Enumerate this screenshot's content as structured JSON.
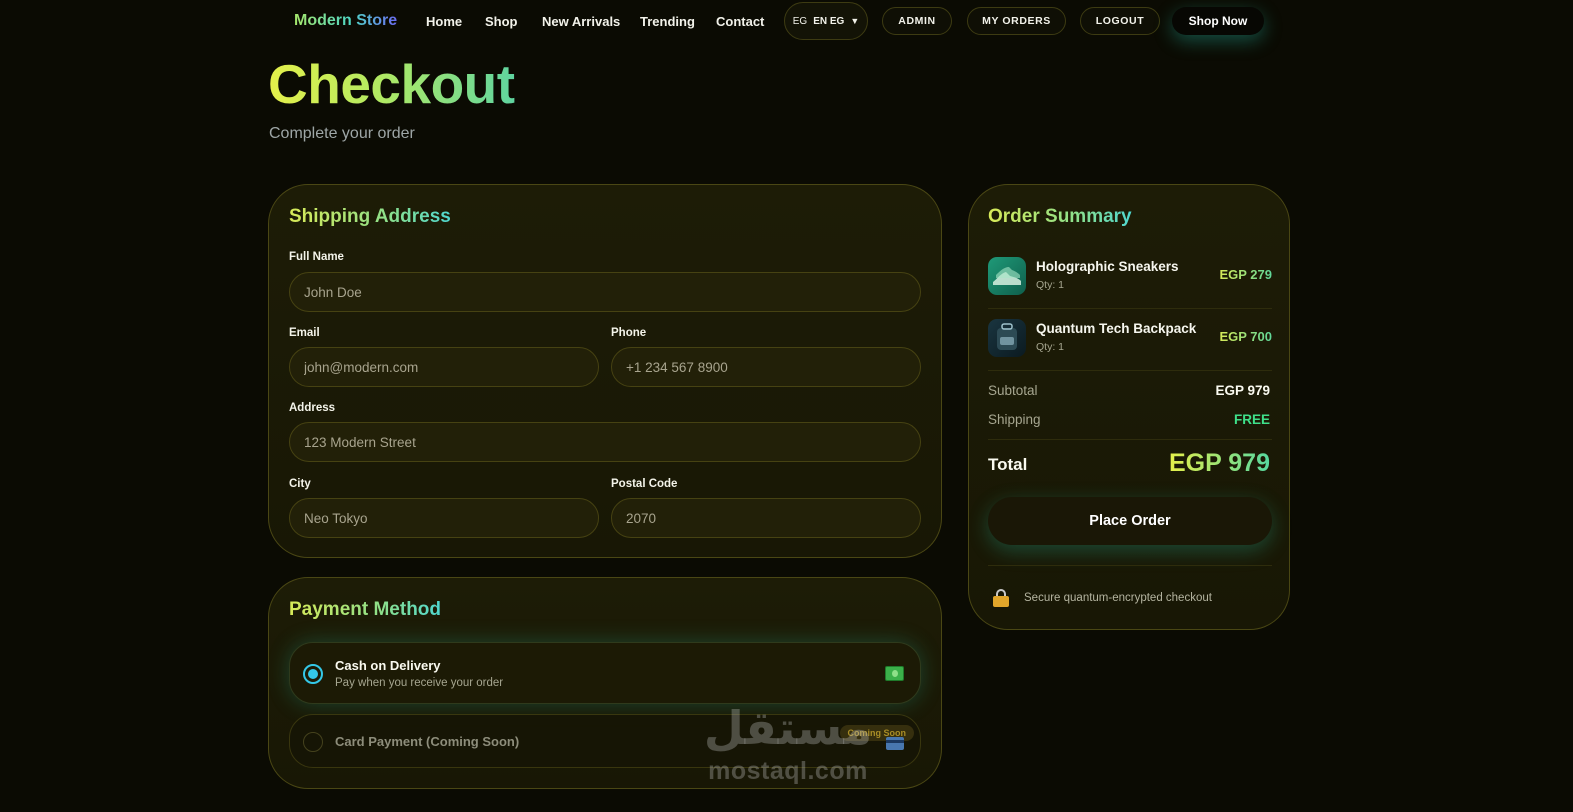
{
  "nav": {
    "brand": "Modern Store",
    "links": [
      "Home",
      "Shop",
      "New Arrivals",
      "Trending",
      "Contact"
    ],
    "language": {
      "flag": "EG",
      "label": "EN EG",
      "caret": "▼"
    },
    "admin_label": "ADMIN",
    "orders_label": "MY ORDERS",
    "logout_label": "LOGOUT",
    "shop_now_label": "Shop Now"
  },
  "header": {
    "title": "Checkout",
    "subtitle": "Complete your order"
  },
  "shipping": {
    "title": "Shipping Address",
    "full_name": {
      "label": "Full Name",
      "placeholder": "John Doe"
    },
    "email": {
      "label": "Email",
      "placeholder": "john@modern.com"
    },
    "phone": {
      "label": "Phone",
      "placeholder": "+1 234 567 8900"
    },
    "address": {
      "label": "Address",
      "placeholder": "123 Modern Street"
    },
    "city": {
      "label": "City",
      "placeholder": "Neo Tokyo"
    },
    "postal": {
      "label": "Postal Code",
      "placeholder": "2070"
    }
  },
  "payment": {
    "title": "Payment Method",
    "options": [
      {
        "title": "Cash on Delivery",
        "description": "Pay when you receive your order",
        "icon": "money-icon",
        "selected": true
      },
      {
        "title": "Card Payment (Coming Soon)",
        "badge": "Coming Soon",
        "icon": "credit-card-icon",
        "selected": false
      }
    ]
  },
  "summary": {
    "title": "Order Summary",
    "items": [
      {
        "name": "Holographic Sneakers",
        "qty": "Qty: 1",
        "price": "EGP 279"
      },
      {
        "name": "Quantum Tech Backpack",
        "qty": "Qty: 1",
        "price": "EGP 700"
      }
    ],
    "subtotal_label": "Subtotal",
    "subtotal_value": "EGP 979",
    "shipping_label": "Shipping",
    "shipping_value": "FREE",
    "total_label": "Total",
    "total_value": "EGP 979",
    "place_order_label": "Place Order",
    "secure_text": "Secure quantum-encrypted checkout"
  },
  "watermark": {
    "arabic": "مستقل",
    "latin": "mostaql.com"
  },
  "colors": {
    "background": "#0b0b03",
    "accent_cyan": "#34c8e8",
    "accent_lime": "#d8ea58",
    "free_green": "#3fe08a"
  }
}
